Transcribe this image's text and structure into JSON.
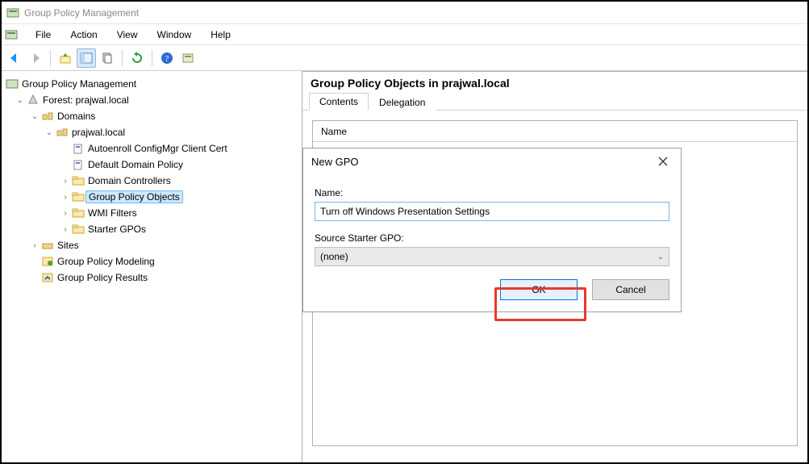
{
  "window": {
    "title": "Group Policy Management"
  },
  "menu": {
    "file": "File",
    "action": "Action",
    "view": "View",
    "window": "Window",
    "help": "Help"
  },
  "tree": {
    "root": "Group Policy Management",
    "forest": "Forest: prajwal.local",
    "domains": "Domains",
    "domain": "prajwal.local",
    "items": {
      "autoenroll": "Autoenroll ConfigMgr Client Cert",
      "default_policy": "Default Domain Policy",
      "domain_controllers": "Domain Controllers",
      "gpo": "Group Policy Objects",
      "wmi": "WMI Filters",
      "starter": "Starter GPOs"
    },
    "sites": "Sites",
    "modeling": "Group Policy Modeling",
    "results": "Group Policy Results"
  },
  "right": {
    "title": "Group Policy Objects in prajwal.local",
    "tabs": {
      "contents": "Contents",
      "delegation": "Delegation"
    },
    "col_name": "Name"
  },
  "dialog": {
    "title": "New GPO",
    "name_label": "Name:",
    "name_value": "Turn off Windows Presentation Settings",
    "starter_label": "Source Starter GPO:",
    "starter_value": "(none)",
    "ok": "OK",
    "cancel": "Cancel"
  }
}
